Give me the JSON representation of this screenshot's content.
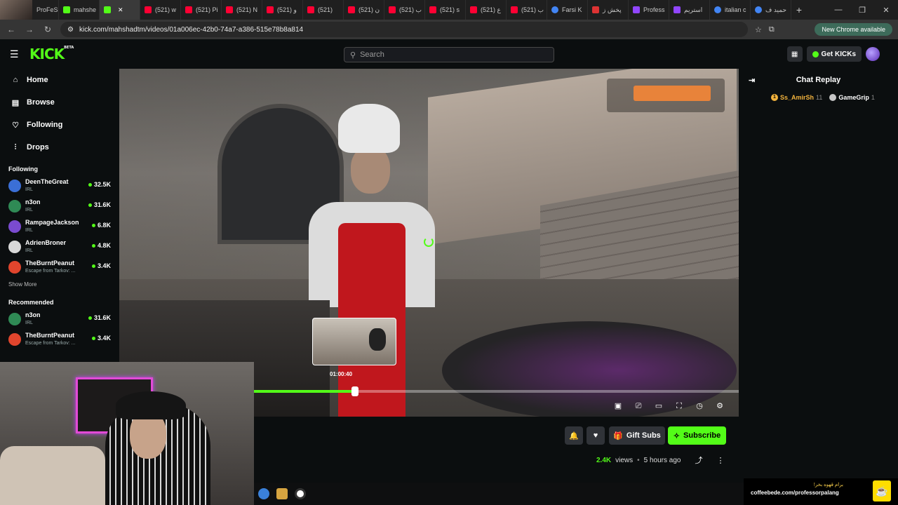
{
  "browser": {
    "tabs": [
      {
        "label": "ProFeSS",
        "fav": "none"
      },
      {
        "label": "mahshe",
        "fav": "kick"
      },
      {
        "label": "",
        "fav": "kick",
        "active": true
      },
      {
        "label": "(521) w",
        "fav": "yt"
      },
      {
        "label": "(521) Pi",
        "fav": "yt"
      },
      {
        "label": "(521) N",
        "fav": "yt"
      },
      {
        "label": "(521) و",
        "fav": "yt"
      },
      {
        "label": "(521)",
        "fav": "yt"
      },
      {
        "label": "(521) ن",
        "fav": "yt"
      },
      {
        "label": "(521) ب",
        "fav": "yt"
      },
      {
        "label": "(521) s",
        "fav": "yt"
      },
      {
        "label": "(521) ع",
        "fav": "yt"
      },
      {
        "label": "(521) ب",
        "fav": "yt"
      },
      {
        "label": "Farsi K",
        "fav": "g"
      },
      {
        "label": "پخش ز",
        "fav": "tw"
      },
      {
        "label": "Profess",
        "fav": "tri"
      },
      {
        "label": "استریم",
        "fav": "tri"
      },
      {
        "label": "italian c",
        "fav": "g"
      },
      {
        "label": "حمید ف",
        "fav": "g"
      }
    ],
    "url": "kick.com/mahshadtm/videos/01a006ec-42b0-74a7-a386-515e78b8a814",
    "update_label": "New Chrome available"
  },
  "kick": {
    "logo": "KICK",
    "logo_badge": "BETA",
    "search_placeholder": "Search",
    "get_kicks": "Get KICKs"
  },
  "sidebar": {
    "nav": [
      {
        "label": "Home",
        "icon": "home-icon",
        "glyph": "⌂"
      },
      {
        "label": "Browse",
        "icon": "browse-icon",
        "glyph": "▤"
      },
      {
        "label": "Following",
        "icon": "heart-icon",
        "glyph": "♡"
      },
      {
        "label": "Drops",
        "icon": "drops-icon",
        "glyph": "⫶"
      }
    ],
    "following_title": "Following",
    "following": [
      {
        "name": "DeenTheGreat",
        "category": "IRL",
        "viewers": "32.5K",
        "color": "#3b6fd6"
      },
      {
        "name": "n3on",
        "category": "IRL",
        "viewers": "31.6K",
        "color": "#2f8a55"
      },
      {
        "name": "RampageJackson",
        "category": "IRL",
        "viewers": "6.8K",
        "color": "#7a4bd0"
      },
      {
        "name": "AdrienBroner",
        "category": "IRL",
        "viewers": "4.8K",
        "color": "#d8d8d8"
      },
      {
        "name": "TheBurntPeanut",
        "category": "Escape from Tarkov: ...",
        "viewers": "3.4K",
        "color": "#e0452d"
      }
    ],
    "show_more": "Show More",
    "recommended_title": "Recommended",
    "recommended": [
      {
        "name": "n3on",
        "category": "IRL",
        "viewers": "31.6K",
        "color": "#2f8a55"
      },
      {
        "name": "TheBurntPeanut",
        "category": "Escape from Tarkov: ...",
        "viewers": "3.4K",
        "color": "#e0452d"
      }
    ]
  },
  "player": {
    "preview_time": "01:00:40",
    "progress_fraction": 0.21
  },
  "chat": {
    "title": "Chat Replay",
    "users": [
      {
        "name": "Ss_AmirSh",
        "count": "11"
      },
      {
        "name": "GameGrip",
        "count": "1"
      }
    ]
  },
  "video": {
    "gift_label": "Gift Subs",
    "subscribe_label": "Subscribe",
    "views": "2.4K",
    "views_label": "views",
    "age": "5 hours ago"
  },
  "coffee": {
    "text": "برام قهوه بخر!",
    "url": "coffeebede.com/professorpalang"
  },
  "colors": {
    "kick_green": "#53fc18",
    "background": "#0b0e0f"
  }
}
